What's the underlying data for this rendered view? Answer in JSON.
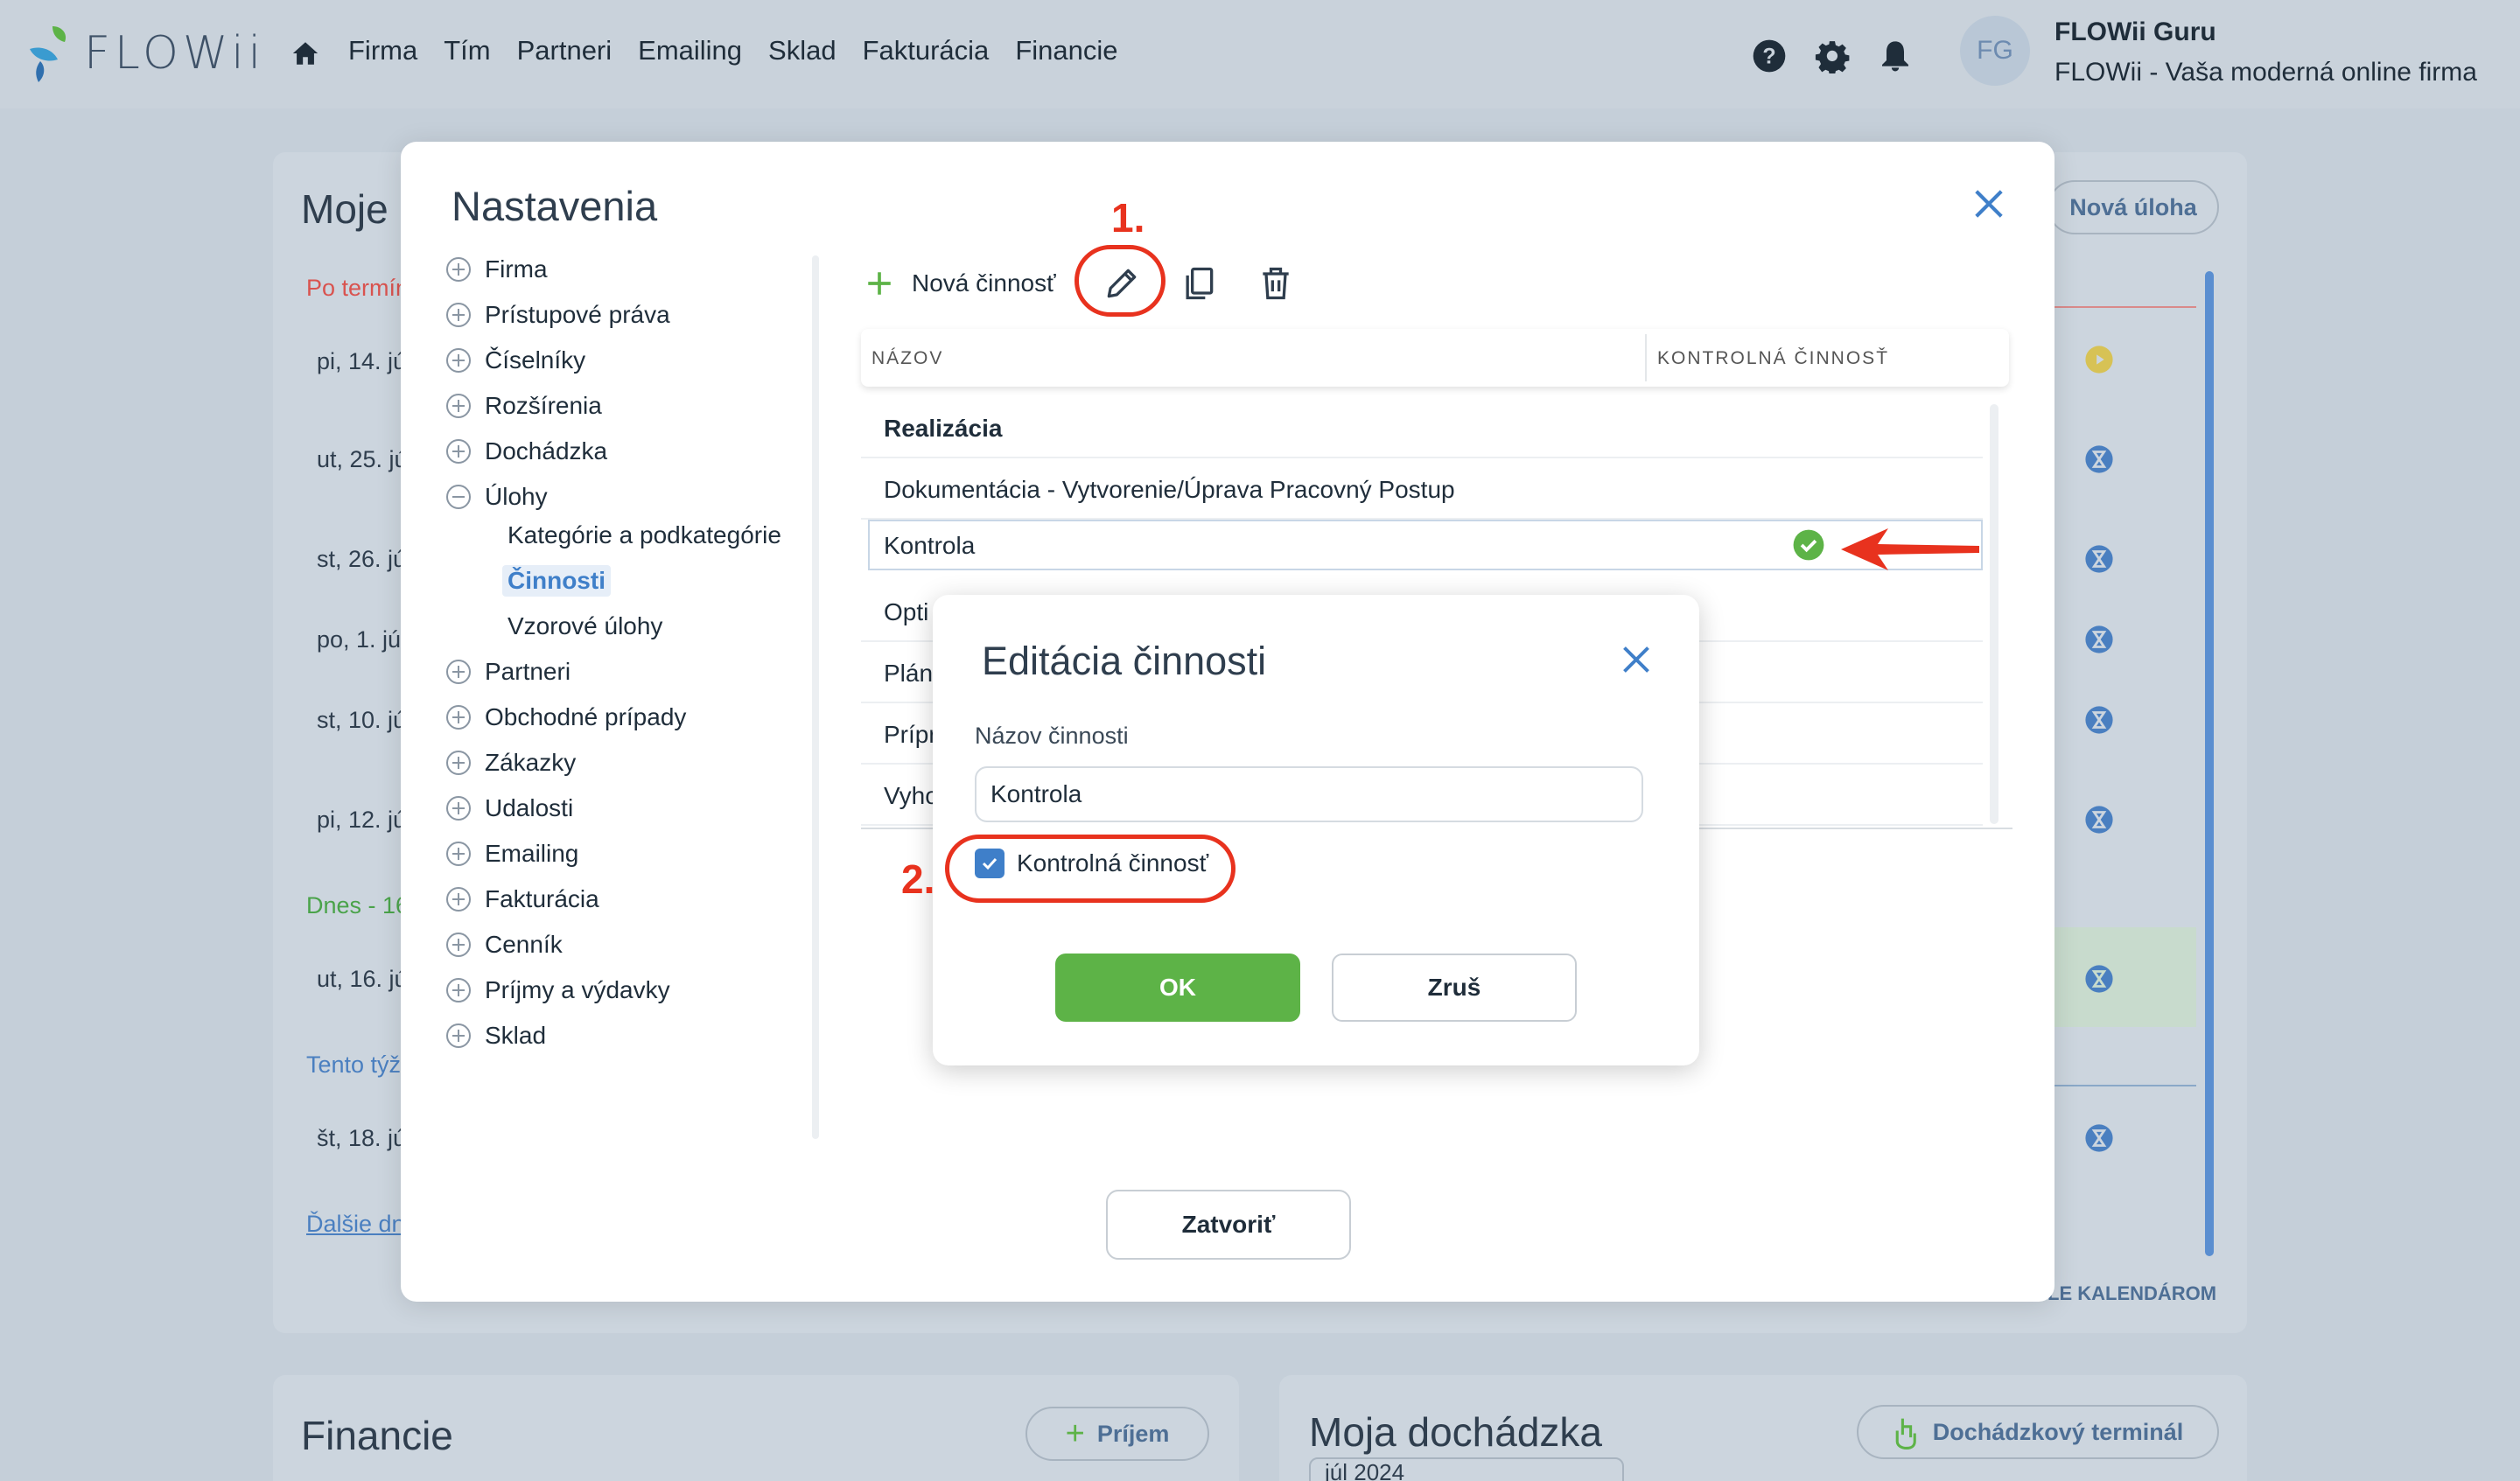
{
  "app": {
    "logo_text": "FLOWii",
    "nav": [
      "Firma",
      "Tím",
      "Partneri",
      "Emailing",
      "Sklad",
      "Fakturácia",
      "Financie"
    ],
    "user_initials": "FG",
    "user_name": "FLOWii Guru",
    "user_firm": "FLOWii - Vaša moderná online firma"
  },
  "background": {
    "tasks_title": "Moje",
    "new_task_button": "Nová úloha",
    "section_overdue": "Po termín",
    "section_today": "Dnes - 16",
    "section_week": "Tento týž",
    "section_more": "Ďalšie dn",
    "rows": [
      "pi, 14. jú",
      "ut, 25. jú",
      "st, 26. jú",
      "po, 1. júl",
      "st, 10. jú",
      "pi, 12. jú",
      "ut, 16. jú",
      "št, 18. jú"
    ],
    "calendar_link": "LE KALENDÁROM",
    "finance_title": "Financie",
    "income_button": "Príjem",
    "attendance_title": "Moja dochádzka",
    "attendance_button": "Dochádzkový terminál",
    "month_value": "júl 2024"
  },
  "settings": {
    "title": "Nastavenia",
    "tree": [
      {
        "label": "Firma",
        "state": "plus"
      },
      {
        "label": "Prístupové práva",
        "state": "plus"
      },
      {
        "label": "Číselníky",
        "state": "plus"
      },
      {
        "label": "Rozšírenia",
        "state": "plus"
      },
      {
        "label": "Dochádzka",
        "state": "plus"
      },
      {
        "label": "Úlohy",
        "state": "minus"
      },
      {
        "label": "Partneri",
        "state": "plus"
      },
      {
        "label": "Obchodné prípady",
        "state": "plus"
      },
      {
        "label": "Zákazky",
        "state": "plus"
      },
      {
        "label": "Udalosti",
        "state": "plus"
      },
      {
        "label": "Emailing",
        "state": "plus"
      },
      {
        "label": "Fakturácia",
        "state": "plus"
      },
      {
        "label": "Cenník",
        "state": "plus"
      },
      {
        "label": "Príjmy a výdavky",
        "state": "plus"
      },
      {
        "label": "Sklad",
        "state": "plus"
      }
    ],
    "tasks_children": [
      "Kategórie a podkategórie",
      "Činnosti",
      "Vzorové úlohy"
    ],
    "toolbar": {
      "new_activity": "Nová činnosť"
    },
    "grid": {
      "columns": [
        "NÁZOV",
        "KONTROLNÁ ČINNOSŤ"
      ],
      "rows": [
        {
          "name": "Realizácia",
          "group": true
        },
        {
          "name": "Dokumentácia - Vytvorenie/Úprava Pracovný Postup"
        },
        {
          "name": "Kontrola",
          "check": true
        },
        {
          "name": "Opti"
        },
        {
          "name": "Plán"
        },
        {
          "name": "Prípr"
        },
        {
          "name": "Vyho"
        }
      ]
    },
    "close_button": "Zatvoriť"
  },
  "edit_dialog": {
    "title": "Editácia činnosti",
    "label": "Názov činnosti",
    "value": "Kontrola",
    "checkbox_label": "Kontrolná činnosť",
    "checkbox_checked": true,
    "ok": "OK",
    "cancel": "Zruš"
  },
  "annotations": {
    "step1": "1.",
    "step2": "2."
  },
  "colors": {
    "accent_blue": "#3f7fc9",
    "ok_green": "#5db347",
    "annotation_red": "#e8321e"
  }
}
